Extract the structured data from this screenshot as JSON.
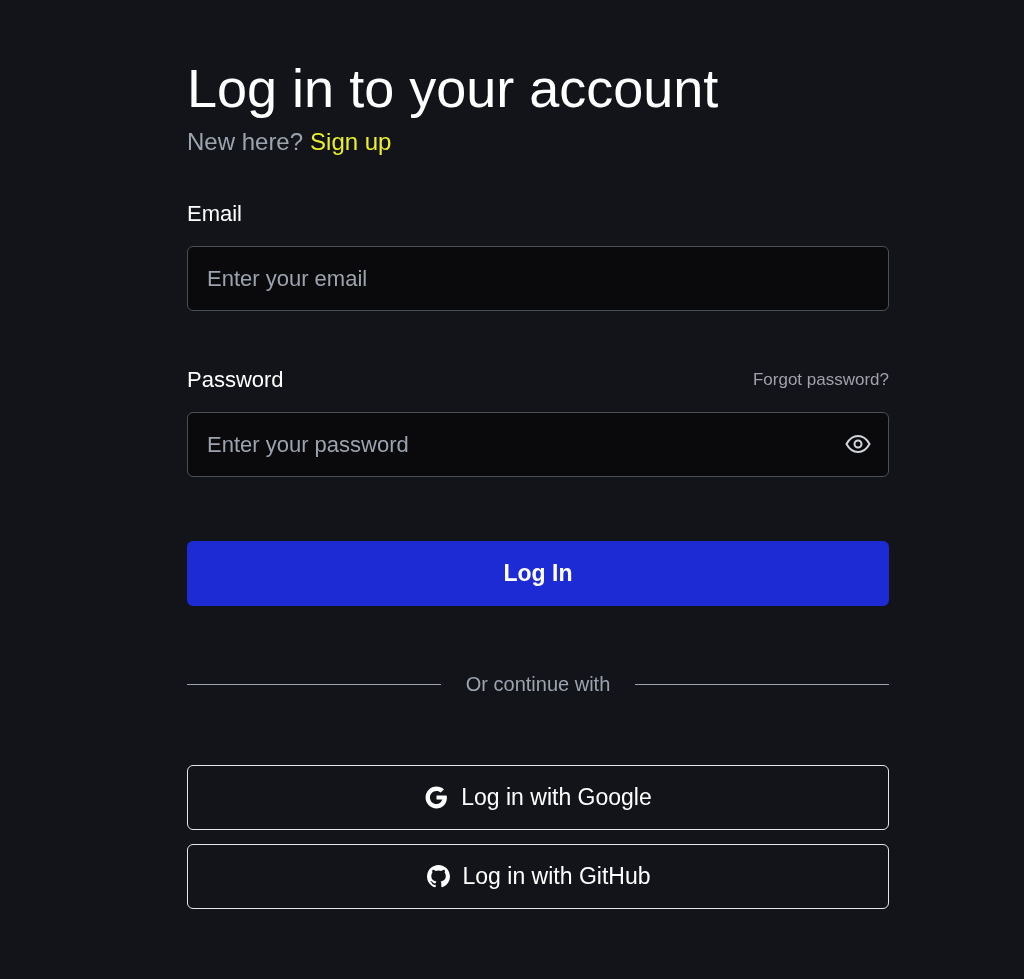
{
  "title": "Log in to your account",
  "signup": {
    "prompt": "New here?",
    "link": "Sign up"
  },
  "fields": [
    {
      "kind": "email",
      "label": "Email",
      "placeholder": "Enter your email"
    },
    {
      "kind": "password",
      "label": "Password",
      "placeholder": "Enter your password",
      "aside": "Forgot password?"
    }
  ],
  "submit": "Log In",
  "divider": "Or continue with",
  "providers": [
    {
      "kind": "google",
      "label": "Log in with Google"
    },
    {
      "kind": "github",
      "label": "Log in with GitHub"
    }
  ]
}
